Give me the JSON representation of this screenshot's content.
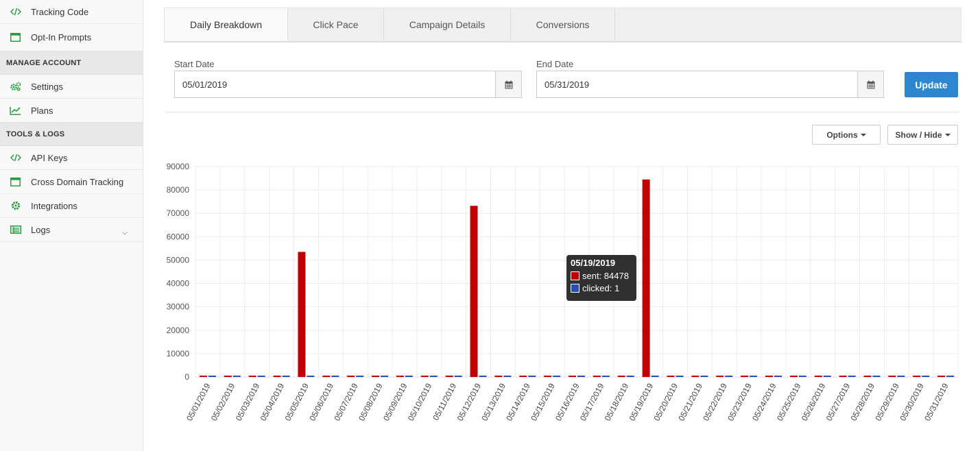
{
  "sidebar": {
    "items_top": [
      {
        "label": "Tracking Code",
        "icon": "code-icon"
      },
      {
        "label": "Opt-In Prompts",
        "icon": "window-icon"
      }
    ],
    "section_manage": "MANAGE ACCOUNT",
    "items_manage": [
      {
        "label": "Settings",
        "icon": "gears-icon"
      },
      {
        "label": "Plans",
        "icon": "line-chart-icon"
      }
    ],
    "section_tools": "TOOLS & LOGS",
    "items_tools": [
      {
        "label": "API Keys",
        "icon": "code-icon"
      },
      {
        "label": "Cross Domain Tracking",
        "icon": "window-icon"
      },
      {
        "label": "Integrations",
        "icon": "gear-icon"
      },
      {
        "label": "Logs",
        "icon": "list-icon"
      }
    ],
    "icon_color": "#2a9d3e"
  },
  "tabs": [
    "Daily Breakdown",
    "Click Pace",
    "Campaign Details",
    "Conversions"
  ],
  "filters": {
    "start_label": "Start Date",
    "start_value": "05/01/2019",
    "end_label": "End Date",
    "end_value": "05/31/2019",
    "update_label": "Update"
  },
  "toolbar": {
    "options_label": "Options",
    "showhide_label": "Show / Hide"
  },
  "tooltip": {
    "date": "05/19/2019",
    "sent_text": "sent: 84478",
    "clicked_text": "clicked: 1"
  },
  "chart_data": {
    "type": "bar",
    "categories": [
      "05/01/2019",
      "05/02/2019",
      "05/03/2019",
      "05/04/2019",
      "05/05/2019",
      "05/06/2019",
      "05/07/2019",
      "05/08/2019",
      "05/09/2019",
      "05/10/2019",
      "05/11/2019",
      "05/12/2019",
      "05/13/2019",
      "05/14/2019",
      "05/15/2019",
      "05/16/2019",
      "05/17/2019",
      "05/18/2019",
      "05/19/2019",
      "05/20/2019",
      "05/21/2019",
      "05/22/2019",
      "05/23/2019",
      "05/24/2019",
      "05/25/2019",
      "05/26/2019",
      "05/27/2019",
      "05/28/2019",
      "05/29/2019",
      "05/30/2019",
      "05/31/2019"
    ],
    "series": [
      {
        "name": "sent",
        "color": "#c00000",
        "values": [
          0,
          0,
          0,
          0,
          53500,
          0,
          0,
          0,
          0,
          0,
          0,
          73200,
          0,
          0,
          0,
          0,
          0,
          0,
          84478,
          0,
          0,
          0,
          0,
          0,
          0,
          0,
          0,
          0,
          0,
          0,
          0
        ]
      },
      {
        "name": "clicked",
        "color": "#2650b8",
        "values": [
          0,
          0,
          0,
          0,
          0,
          300,
          0,
          0,
          0,
          0,
          0,
          0,
          400,
          0,
          0,
          0,
          0,
          0,
          1,
          300,
          0,
          0,
          0,
          0,
          0,
          0,
          0,
          0,
          0,
          0,
          0
        ]
      }
    ],
    "yticks": [
      0,
      10000,
      20000,
      30000,
      40000,
      50000,
      60000,
      70000,
      80000,
      90000
    ],
    "ylim": [
      0,
      90000
    ],
    "grid": true
  }
}
